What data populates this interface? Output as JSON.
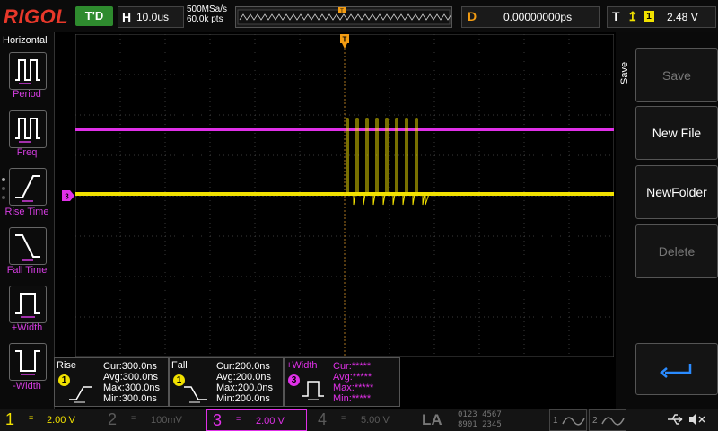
{
  "header": {
    "logo": "RIGOL",
    "trigger_status": "T'D",
    "horizontal_letter": "H",
    "timebase": "10.0us",
    "sample_rate": "500MSa/s",
    "memory_depth": "60.0k pts",
    "delay_letter": "D",
    "delay": "0.00000000ps",
    "trigger_letter": "T",
    "trigger_source": "1",
    "trigger_level": "2.48 V"
  },
  "left_menu": {
    "title": "Horizontal",
    "items": [
      {
        "label": "Period",
        "icon": "period-icon"
      },
      {
        "label": "Freq",
        "icon": "frequency-icon"
      },
      {
        "label": "Rise Time",
        "icon": "rise-time-icon"
      },
      {
        "label": "Fall Time",
        "icon": "fall-time-icon"
      },
      {
        "label": "+Width",
        "icon": "positive-width-icon"
      },
      {
        "label": "-Width",
        "icon": "negative-width-icon"
      }
    ]
  },
  "right_menu": {
    "title": "Save",
    "items": [
      {
        "label": "Save",
        "enabled": false
      },
      {
        "label": "New File",
        "enabled": true
      },
      {
        "label": "NewFolder",
        "enabled": true
      },
      {
        "label": "Delete",
        "enabled": false
      },
      {
        "label": "",
        "icon": "enter-icon",
        "enabled": true
      }
    ]
  },
  "waveform_markers": {
    "trigger_pos_label": "T",
    "trigger_level_label": "T",
    "channel3_label": "3"
  },
  "measurements": [
    {
      "name": "Rise",
      "channel": "1",
      "cur": "Cur:300.0ns",
      "avg": "Avg:300.0ns",
      "max": "Max:300.0ns",
      "min": "Min:300.0ns"
    },
    {
      "name": "Fall",
      "channel": "1",
      "cur": "Cur:200.0ns",
      "avg": "Avg:200.0ns",
      "max": "Max:200.0ns",
      "min": "Min:200.0ns"
    },
    {
      "name": "+Width",
      "channel": "3",
      "cur": "Cur:*****",
      "avg": "Avg:*****",
      "max": "Max:*****",
      "min": "Min:*****"
    }
  ],
  "channels": [
    {
      "num": "1",
      "coupling": "=",
      "scale": "2.00 V",
      "color": "#f1e100",
      "active": true
    },
    {
      "num": "2",
      "coupling": "=",
      "scale": "100mV",
      "color": "#5a5a5a",
      "active": false
    },
    {
      "num": "3",
      "coupling": "=",
      "scale": "2.00 V",
      "color": "#d43de0",
      "active": true
    },
    {
      "num": "4",
      "coupling": "=",
      "scale": "5.00 V",
      "color": "#5a5a5a",
      "active": false
    }
  ],
  "la": {
    "label": "LA",
    "bits_top": "0123 4567",
    "bits_bottom": "8901 2345"
  },
  "gens": [
    {
      "num": "1"
    },
    {
      "num": "2"
    }
  ],
  "colors": {
    "ch1": "#f1e100",
    "ch3": "#e030e8",
    "trigger_marker": "#f39c12",
    "grid": "#3a3a3a",
    "status_green": "#2e8b2e",
    "logo": "#e8382a"
  }
}
